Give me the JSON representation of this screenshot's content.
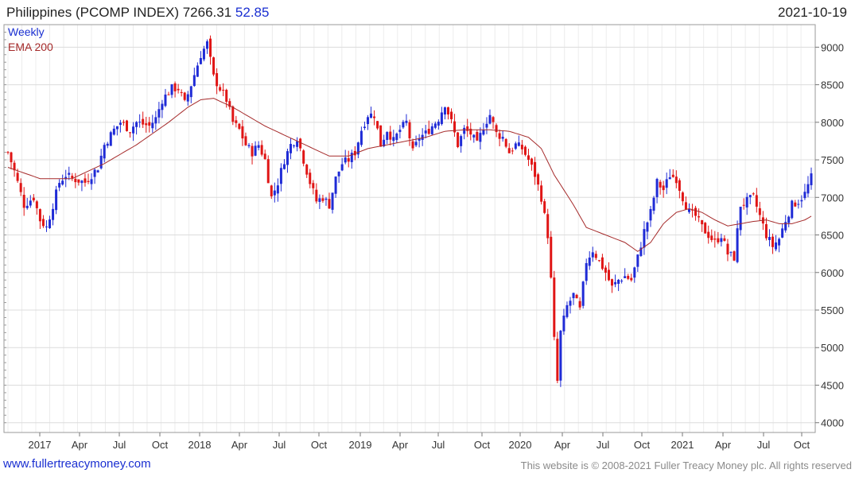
{
  "header": {
    "name": "Philippines (PCOMP INDEX)",
    "last": "7266.31",
    "change": "52.85",
    "date": "2021-10-19"
  },
  "footer": {
    "site": "www.fullertreacymoney.com",
    "copyright": "This website is © 2008-2021 Fuller Treacy Money plc. All rights reserved"
  },
  "chart_data": {
    "type": "candlestick",
    "frequency_label": "Weekly",
    "indicator_label": "EMA 200",
    "y_ticks": [
      4000,
      4500,
      5000,
      5500,
      6000,
      6500,
      7000,
      7500,
      8000,
      8500,
      9000
    ],
    "ylim": [
      3870,
      9300
    ],
    "x_ticks": [
      "2017",
      "Apr",
      "Jul",
      "Oct",
      "2018",
      "Apr",
      "Jul",
      "Oct",
      "2019",
      "Apr",
      "Jul",
      "Oct",
      "2020",
      "Apr",
      "Jul",
      "Oct",
      "2021",
      "Apr",
      "Jul",
      "Oct"
    ],
    "up_color": "#1f2bd6",
    "down_color": "#e01515",
    "ema_color": "#a52a2a",
    "close_path": [
      [
        0,
        7600
      ],
      [
        2,
        7350
      ],
      [
        5,
        6900
      ],
      [
        8,
        7000
      ],
      [
        10,
        6700
      ],
      [
        12,
        6600
      ],
      [
        14,
        6900
      ],
      [
        16,
        7200
      ],
      [
        18,
        7300
      ],
      [
        20,
        7250
      ],
      [
        24,
        7200
      ],
      [
        26,
        7300
      ],
      [
        28,
        7400
      ],
      [
        30,
        7700
      ],
      [
        33,
        7900
      ],
      [
        35,
        8000
      ],
      [
        38,
        7900
      ],
      [
        40,
        8000
      ],
      [
        44,
        7950
      ],
      [
        46,
        8050
      ],
      [
        48,
        8300
      ],
      [
        51,
        8450
      ],
      [
        53,
        8450
      ],
      [
        55,
        8250
      ],
      [
        57,
        8500
      ],
      [
        60,
        8900
      ],
      [
        62,
        9050
      ],
      [
        64,
        8600
      ],
      [
        66,
        8450
      ],
      [
        68,
        8300
      ],
      [
        70,
        8000
      ],
      [
        72,
        7900
      ],
      [
        74,
        7700
      ],
      [
        76,
        7600
      ],
      [
        78,
        7700
      ],
      [
        80,
        7500
      ],
      [
        82,
        7000
      ],
      [
        84,
        7200
      ],
      [
        86,
        7500
      ],
      [
        88,
        7700
      ],
      [
        90,
        7800
      ],
      [
        92,
        7500
      ],
      [
        94,
        7200
      ],
      [
        96,
        6950
      ],
      [
        98,
        7000
      ],
      [
        100,
        6900
      ],
      [
        102,
        7250
      ],
      [
        104,
        7450
      ],
      [
        106,
        7500
      ],
      [
        108,
        7600
      ],
      [
        110,
        7900
      ],
      [
        112,
        8100
      ],
      [
        114,
        8100
      ],
      [
        116,
        7700
      ],
      [
        118,
        7900
      ],
      [
        120,
        7750
      ],
      [
        122,
        7900
      ],
      [
        124,
        8000
      ],
      [
        126,
        7600
      ],
      [
        128,
        7800
      ],
      [
        130,
        7850
      ],
      [
        132,
        7950
      ],
      [
        134,
        8050
      ],
      [
        136,
        8250
      ],
      [
        138,
        8000
      ],
      [
        140,
        7700
      ],
      [
        142,
        7900
      ],
      [
        144,
        7850
      ],
      [
        146,
        7700
      ],
      [
        148,
        7950
      ],
      [
        150,
        8100
      ],
      [
        152,
        7850
      ],
      [
        154,
        7800
      ],
      [
        156,
        7600
      ],
      [
        158,
        7700
      ],
      [
        160,
        7650
      ],
      [
        162,
        7500
      ],
      [
        164,
        7300
      ],
      [
        166,
        7000
      ],
      [
        167,
        6750
      ],
      [
        168,
        6500
      ],
      [
        169,
        5900
      ],
      [
        170,
        5100
      ],
      [
        171,
        4550
      ],
      [
        172,
        5200
      ],
      [
        174,
        5550
      ],
      [
        176,
        5700
      ],
      [
        178,
        5500
      ],
      [
        180,
        6150
      ],
      [
        182,
        6300
      ],
      [
        184,
        6150
      ],
      [
        186,
        6000
      ],
      [
        188,
        5800
      ],
      [
        190,
        5900
      ],
      [
        192,
        5950
      ],
      [
        194,
        5900
      ],
      [
        196,
        6200
      ],
      [
        198,
        6550
      ],
      [
        200,
        6800
      ],
      [
        202,
        7200
      ],
      [
        204,
        7100
      ],
      [
        206,
        7300
      ],
      [
        208,
        7250
      ],
      [
        210,
        7000
      ],
      [
        212,
        6800
      ],
      [
        214,
        6750
      ],
      [
        216,
        6600
      ],
      [
        218,
        6500
      ],
      [
        220,
        6400
      ],
      [
        222,
        6500
      ],
      [
        224,
        6250
      ],
      [
        226,
        6200
      ],
      [
        228,
        6900
      ],
      [
        230,
        6950
      ],
      [
        232,
        7000
      ],
      [
        234,
        6750
      ],
      [
        236,
        6500
      ],
      [
        238,
        6350
      ],
      [
        240,
        6450
      ],
      [
        242,
        6700
      ],
      [
        244,
        6900
      ],
      [
        246,
        6950
      ],
      [
        248,
        7050
      ],
      [
        250,
        7266
      ]
    ],
    "ema_path": [
      [
        0,
        7400
      ],
      [
        10,
        7250
      ],
      [
        20,
        7250
      ],
      [
        30,
        7450
      ],
      [
        40,
        7700
      ],
      [
        50,
        8000
      ],
      [
        56,
        8200
      ],
      [
        60,
        8300
      ],
      [
        64,
        8320
      ],
      [
        70,
        8200
      ],
      [
        80,
        7950
      ],
      [
        90,
        7750
      ],
      [
        100,
        7550
      ],
      [
        106,
        7550
      ],
      [
        112,
        7650
      ],
      [
        118,
        7700
      ],
      [
        124,
        7750
      ],
      [
        130,
        7800
      ],
      [
        136,
        7880
      ],
      [
        142,
        7900
      ],
      [
        150,
        7900
      ],
      [
        156,
        7880
      ],
      [
        162,
        7800
      ],
      [
        166,
        7650
      ],
      [
        170,
        7300
      ],
      [
        176,
        6900
      ],
      [
        180,
        6600
      ],
      [
        186,
        6500
      ],
      [
        192,
        6400
      ],
      [
        196,
        6280
      ],
      [
        200,
        6400
      ],
      [
        204,
        6650
      ],
      [
        208,
        6800
      ],
      [
        212,
        6850
      ],
      [
        216,
        6800
      ],
      [
        220,
        6700
      ],
      [
        224,
        6620
      ],
      [
        228,
        6650
      ],
      [
        232,
        6680
      ],
      [
        236,
        6700
      ],
      [
        240,
        6650
      ],
      [
        244,
        6650
      ],
      [
        248,
        6700
      ],
      [
        250,
        6750
      ]
    ]
  }
}
